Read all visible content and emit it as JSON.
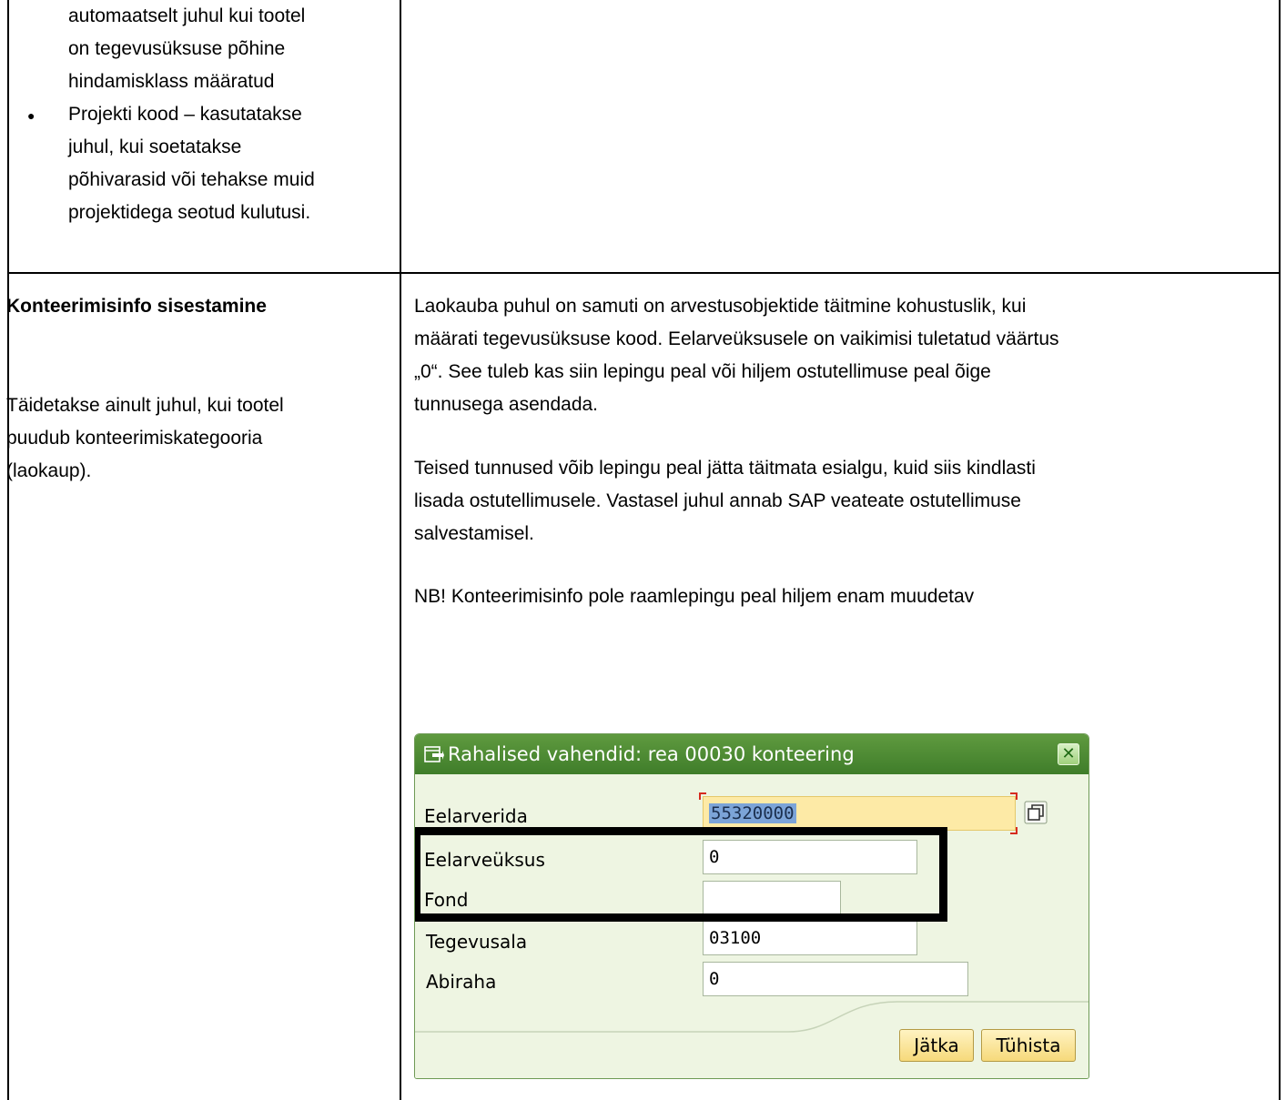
{
  "top_row": {
    "left_lines": [
      "automaatselt juhul kui tootel",
      "on tegevusüksuse põhine",
      "hindamisklass määratud",
      "Projekti kood – kasutatakse",
      "juhul, kui soetatakse",
      "põhivarasid või tehakse muid",
      "projektidega seotud kulutusi."
    ]
  },
  "second_row": {
    "heading": "Konteerimisinfo sisestamine",
    "note_lines": [
      "Täidetakse ainult juhul, kui tootel",
      "puudub konteerimiskategooria",
      "(laokaup)."
    ],
    "paragraph1_lines": [
      "Laokauba puhul on samuti on arvestusobjektide täitmine kohustuslik, kui",
      "määrati tegevusüksuse kood. Eelarveüksusele  on vaikimisi tuletatud väärtus",
      "„0“. See tuleb kas siin lepingu peal või hiljem ostutellimuse peal õige",
      "tunnusega asendada."
    ],
    "paragraph2_lines": [
      "Teised tunnused võib lepingu peal jätta täitmata esialgu, kuid siis kindlasti",
      "lisada ostutellimusele. Vastasel juhul annab SAP veateate ostutellimuse",
      "salvestamisel."
    ],
    "paragraph3": "NB! Konteerimisinfo pole raamlepingu peal hiljem enam muudetav"
  },
  "dialog": {
    "title": "Rahalised vahendid: rea 00030 konteering",
    "fields": [
      {
        "label": "Eelarverida",
        "value": "55320000"
      },
      {
        "label": "Eelarveüksus",
        "value": "0"
      },
      {
        "label": "Fond",
        "value": ""
      },
      {
        "label": "Tegevusala",
        "value": "03100"
      },
      {
        "label": "Abiraha",
        "value": "0"
      }
    ],
    "buttons": {
      "continue": "Jätka",
      "cancel": "Tühista"
    }
  },
  "colors": {
    "titlebar": "#4a8a33",
    "dialog_bg": "#eef5e2",
    "required_field": "#fdeaa6",
    "button": "#f6d97a"
  }
}
